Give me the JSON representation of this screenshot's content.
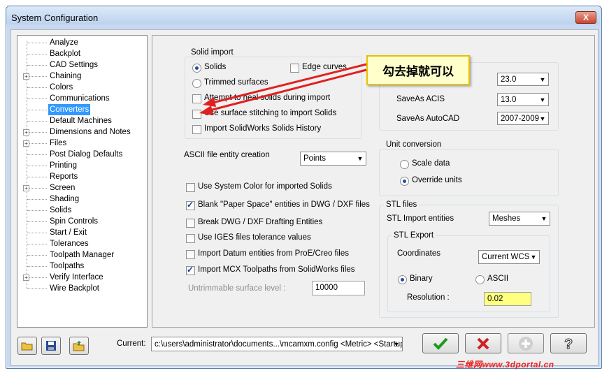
{
  "window": {
    "title": "System Configuration",
    "close_label": "X"
  },
  "tree": {
    "items": [
      {
        "label": "Analyze",
        "expandable": false
      },
      {
        "label": "Backplot",
        "expandable": false
      },
      {
        "label": "CAD Settings",
        "expandable": false
      },
      {
        "label": "Chaining",
        "expandable": true
      },
      {
        "label": "Colors",
        "expandable": false
      },
      {
        "label": "Communications",
        "expandable": false
      },
      {
        "label": "Converters",
        "expandable": false,
        "selected": true
      },
      {
        "label": "Default Machines",
        "expandable": false
      },
      {
        "label": "Dimensions and Notes",
        "expandable": true
      },
      {
        "label": "Files",
        "expandable": true
      },
      {
        "label": "Post Dialog Defaults",
        "expandable": false
      },
      {
        "label": "Printing",
        "expandable": false
      },
      {
        "label": "Reports",
        "expandable": false
      },
      {
        "label": "Screen",
        "expandable": true
      },
      {
        "label": "Shading",
        "expandable": false
      },
      {
        "label": "Solids",
        "expandable": false
      },
      {
        "label": "Spin Controls",
        "expandable": false
      },
      {
        "label": "Start / Exit",
        "expandable": false
      },
      {
        "label": "Tolerances",
        "expandable": false
      },
      {
        "label": "Toolpath Manager",
        "expandable": false
      },
      {
        "label": "Toolpaths",
        "expandable": false
      },
      {
        "label": "Verify Interface",
        "expandable": true
      },
      {
        "label": "Wire Backplot",
        "expandable": false
      }
    ]
  },
  "solid_import": {
    "title": "Solid import",
    "solids": "Solids",
    "trimmed": "Trimmed surfaces",
    "edge_curves": "Edge curves",
    "attempt_heal": "Attempt to heal solids during import",
    "stitching": "Use surface stitching to import Solids",
    "history": "Import SolidWorks Solids History"
  },
  "saveas": {
    "v1_value": "23.0",
    "acis_label": "SaveAs ACIS",
    "acis_value": "13.0",
    "autocad_label": "SaveAs AutoCAD",
    "autocad_value": "2007-2009"
  },
  "callout": {
    "text": "勾去掉就可以"
  },
  "ascii": {
    "label": "ASCII file entity creation",
    "value": "Points"
  },
  "options": {
    "system_color": "Use System Color for imported Solids",
    "blank_paper": "Blank \"Paper Space\" entities in DWG / DXF files",
    "break_dwg": "Break DWG / DXF Drafting Entities",
    "iges_tol": "Use IGES files tolerance values",
    "datum": "Import Datum entities from ProE/Creo files",
    "mcx_toolpaths": "Import MCX Toolpaths from SolidWorks files",
    "untrimmable_label": "Untrimmable surface level :",
    "untrimmable_value": "10000"
  },
  "unit_conversion": {
    "title": "Unit conversion",
    "scale": "Scale data",
    "override": "Override units"
  },
  "stl": {
    "title": "STL files",
    "import_label": "STL Import entities",
    "import_value": "Meshes",
    "export_title": "STL Export",
    "coord_label": "Coordinates",
    "coord_value": "Current WCS",
    "binary": "Binary",
    "ascii": "ASCII",
    "res_label": "Resolution :",
    "res_value": "0.02"
  },
  "footer": {
    "current_label": "Current:",
    "current_value": "c:\\users\\administrator\\documents...\\mcamxm.config <Metric> <Startup:"
  },
  "watermark": "三维网www.3dportal.cn",
  "colors": {
    "accent_red": "#e02020",
    "highlight_yellow": "#ffff80",
    "selection_blue": "#3399ff"
  }
}
